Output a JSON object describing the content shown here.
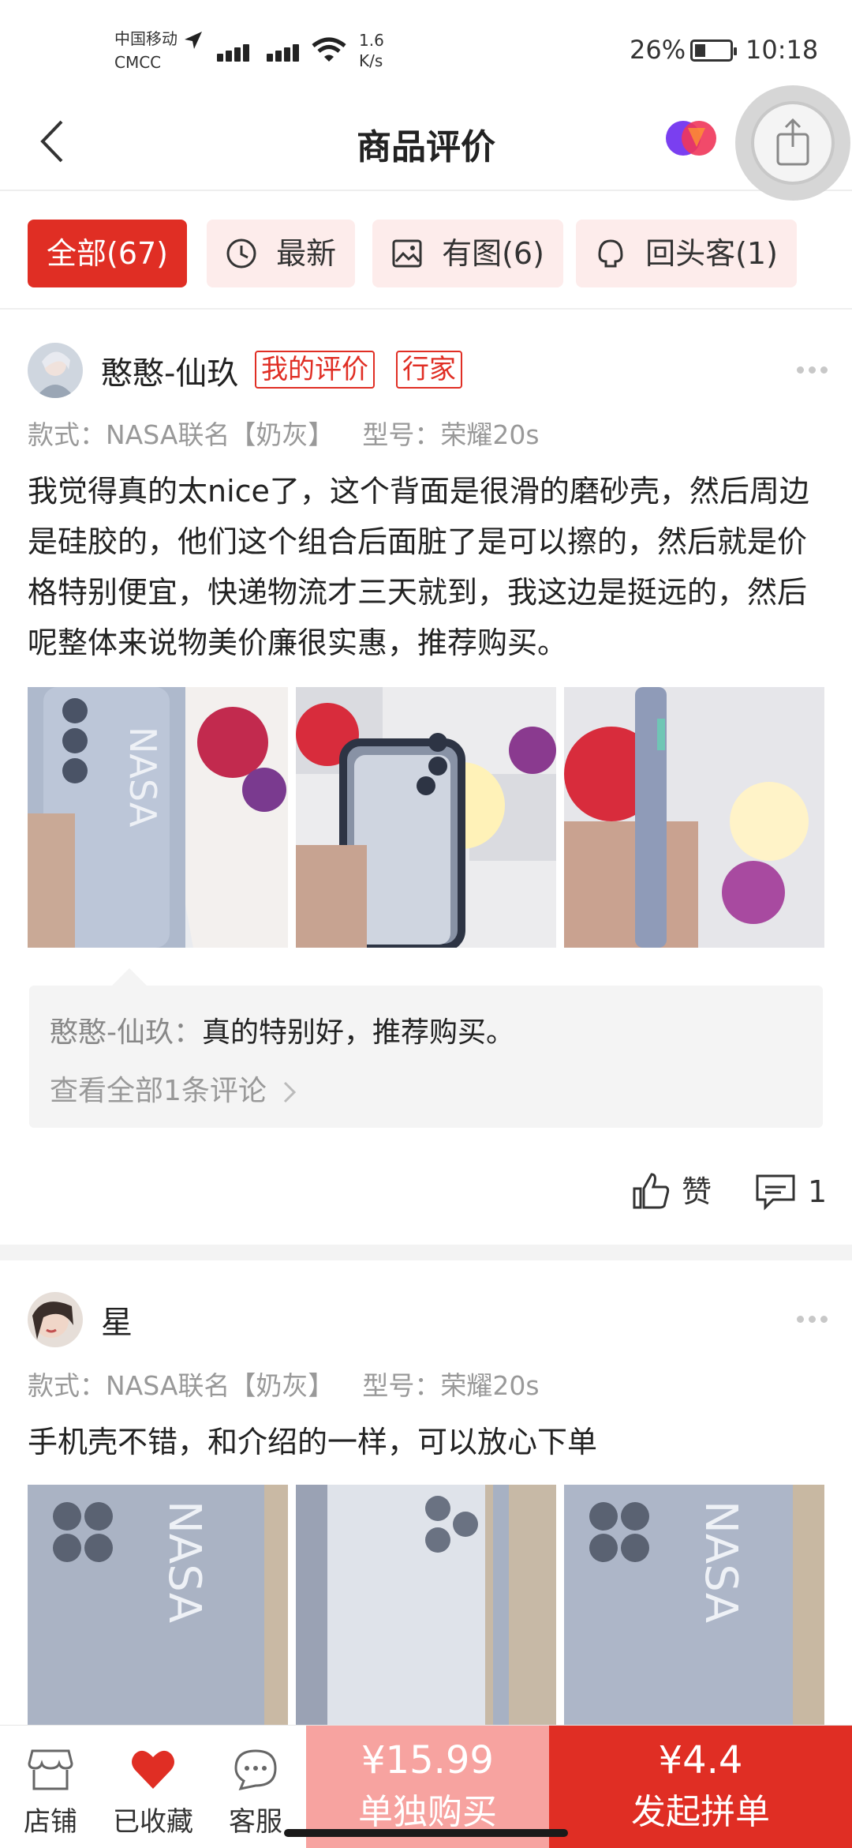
{
  "status_bar": {
    "carrier_line1": "中国移动",
    "carrier_line2": "CMCC",
    "net_speed_value": "1.6",
    "net_speed_unit": "K/s",
    "battery_pct": "26%",
    "time": "10:18"
  },
  "header": {
    "title": "商品评价"
  },
  "filters": [
    {
      "label": "全部(67)",
      "active": true
    },
    {
      "label": "最新",
      "icon": "clock-icon"
    },
    {
      "label": "有图(6)",
      "icon": "image-icon"
    },
    {
      "label": "回头客(1)",
      "icon": "repeat-customer-icon"
    }
  ],
  "reviews": [
    {
      "username": "憨憨-仙玖",
      "tags": [
        "我的评价",
        "行家"
      ],
      "style_label": "款式：NASA联名【奶灰】",
      "model_label": "型号：荣耀20s",
      "text": "我觉得真的太nice了，这个背面是很滑的磨砂壳，然后周边是硅胶的，他们这个组合后面脏了是可以擦的，然后就是价格特别便宜，快递物流才三天就到，我这边是挺远的，然后呢整体来说物美价廉很实惠，推荐购买。",
      "reply_author": "憨憨-仙玖：",
      "reply_text": "真的特别好，推荐购买。",
      "view_all": "查看全部1条评论",
      "like_label": "赞",
      "comment_count": "1"
    },
    {
      "username": "星",
      "style_label": "款式：NASA联名【奶灰】",
      "model_label": "型号：荣耀20s",
      "text": "手机壳不错，和介绍的一样，可以放心下单"
    }
  ],
  "bottom_bar": {
    "shop_label": "店铺",
    "fav_label": "已收藏",
    "service_label": "客服",
    "single_price": "¥15.99",
    "single_label": "单独购买",
    "group_price": "¥4.4",
    "group_label": "发起拼单"
  },
  "colors": {
    "accent": "#e02e24",
    "accent_light": "#f7a3a0",
    "chip_bg": "#fdeceb"
  }
}
